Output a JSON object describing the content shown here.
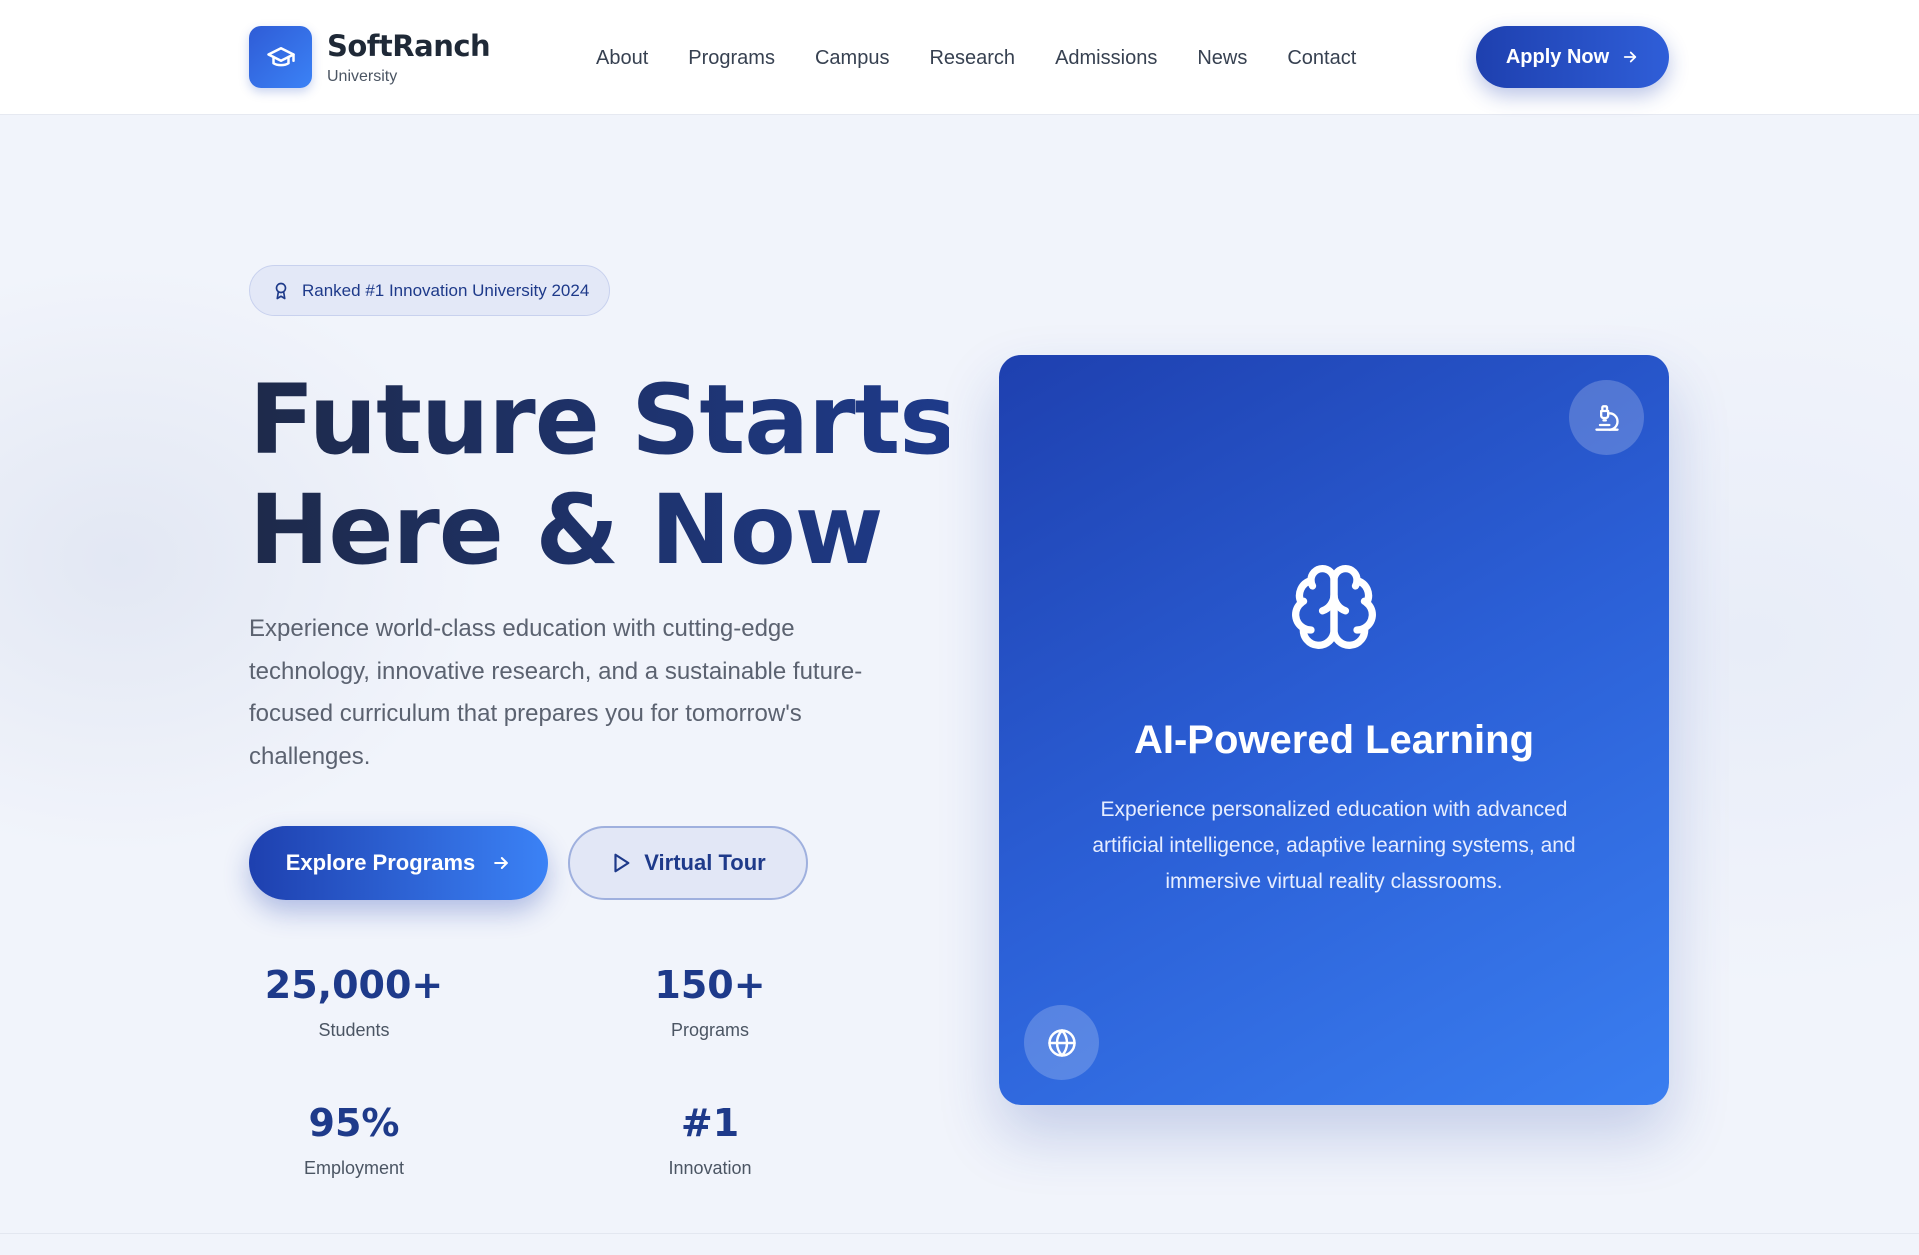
{
  "brand": {
    "name": "SoftRanch",
    "subtitle": "University"
  },
  "nav": {
    "items": [
      "About",
      "Programs",
      "Campus",
      "Research",
      "Admissions",
      "News",
      "Contact"
    ]
  },
  "header": {
    "apply_label": "Apply Now"
  },
  "hero": {
    "badge": "Ranked #1 Innovation University 2024",
    "title_line1": "Future Starts",
    "title_line2": "Here & Now",
    "description": "Experience world-class education with cutting-edge technology, innovative research, and a sustainable future-focused curriculum that prepares you for tomorrow's challenges.",
    "primary_cta": "Explore Programs",
    "secondary_cta": "Virtual Tour"
  },
  "stats": [
    {
      "value": "25,000+",
      "label": "Students"
    },
    {
      "value": "150+",
      "label": "Programs"
    },
    {
      "value": "95%",
      "label": "Employment"
    },
    {
      "value": "#1",
      "label": "Innovation"
    }
  ],
  "feature_card": {
    "title": "AI-Powered Learning",
    "description": "Experience personalized education with advanced artificial intelligence, adaptive learning systems, and immersive virtual reality classrooms.",
    "icons": [
      "microscope-icon",
      "brain-icon",
      "globe-icon"
    ]
  },
  "colors": {
    "primary": "#1e40af",
    "accent": "#3b82f6",
    "heading": "#1e2a4a",
    "text_muted": "#5b6270",
    "background": "#f1f4fb"
  }
}
